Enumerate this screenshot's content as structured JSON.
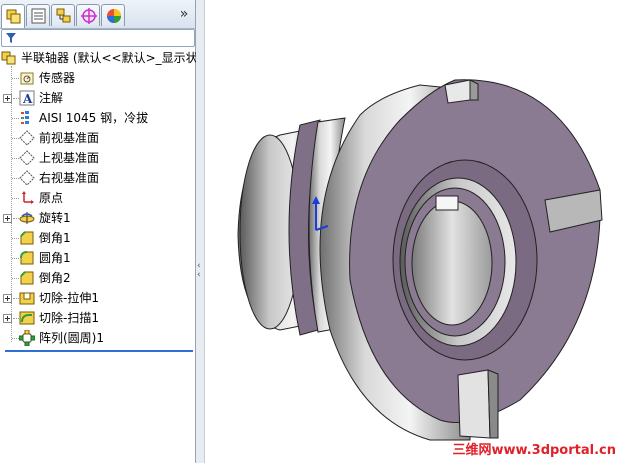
{
  "panel": {
    "tabs": [
      "feature-manager",
      "property-manager",
      "configuration-manager",
      "dimxpert-manager",
      "display-manager"
    ],
    "more_label": "»"
  },
  "tree": {
    "root": "半联轴器 (默认<<默认>_显示状",
    "items": [
      {
        "label": "传感器",
        "icon": "sensor-icon",
        "expandable": false
      },
      {
        "label": "注解",
        "icon": "annotation-icon",
        "expandable": true
      },
      {
        "label": "AISI 1045 钢，冷拔",
        "icon": "material-icon",
        "expandable": false
      },
      {
        "label": "前视基准面",
        "icon": "plane-icon",
        "expandable": false
      },
      {
        "label": "上视基准面",
        "icon": "plane-icon",
        "expandable": false
      },
      {
        "label": "右视基准面",
        "icon": "plane-icon",
        "expandable": false
      },
      {
        "label": "原点",
        "icon": "origin-icon",
        "expandable": false
      },
      {
        "label": "旋转1",
        "icon": "revolve-icon",
        "expandable": true
      },
      {
        "label": "倒角1",
        "icon": "chamfer-icon",
        "expandable": false
      },
      {
        "label": "圆角1",
        "icon": "fillet-icon",
        "expandable": false
      },
      {
        "label": "倒角2",
        "icon": "chamfer-icon",
        "expandable": false
      },
      {
        "label": "切除-拉伸1",
        "icon": "cut-extrude-icon",
        "expandable": true
      },
      {
        "label": "切除-扫描1",
        "icon": "cut-sweep-icon",
        "expandable": true
      },
      {
        "label": "阵列(圆周)1",
        "icon": "circular-pattern-icon",
        "expandable": false
      }
    ]
  },
  "viewport": {
    "watermark": "三维网www.3dportal.cn"
  },
  "colors": {
    "part_face_purple": "#8a7a92",
    "part_metal": "#a8a8a8",
    "watermark_red": "#e0202a",
    "rollback_blue": "#2f6fd6"
  }
}
